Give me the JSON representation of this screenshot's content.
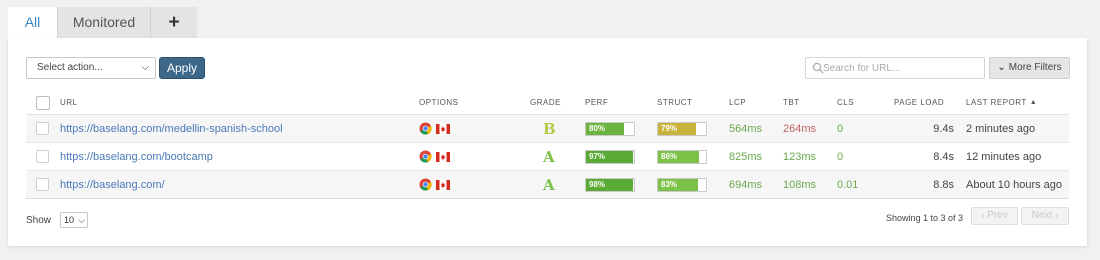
{
  "tabs": [
    {
      "label": "All"
    },
    {
      "label": "Monitored"
    },
    {
      "label": "+"
    }
  ],
  "toolbar": {
    "select_action": "Select action...",
    "apply": "Apply",
    "search_placeholder": "Search for URL...",
    "more_filters": "More Filters"
  },
  "columns": {
    "url": "URL",
    "options": "OPTIONS",
    "grade": "GRADE",
    "perf": "PERF",
    "struct": "STRUCT",
    "lcp": "LCP",
    "tbt": "TBT",
    "cls": "CLS",
    "page_load": "PAGE LOAD",
    "last_report": "LAST REPORT"
  },
  "rows": [
    {
      "url": "https://baselang.com/medellin-spanish-school",
      "grade": "B",
      "perf": "80%",
      "perf_value": 80,
      "perf_color": "#6cb33f",
      "struct": "79%",
      "struct_value": 79,
      "struct_color": "#c8b23a",
      "lcp": "564ms",
      "tbt": "264ms",
      "tbt_status": "red",
      "cls": "0",
      "page_load": "9.4s",
      "last_report": "2 minutes ago"
    },
    {
      "url": "https://baselang.com/bootcamp",
      "grade": "A",
      "perf": "97%",
      "perf_value": 97,
      "perf_color": "#5aaa35",
      "struct": "86%",
      "struct_value": 86,
      "struct_color": "#7cc248",
      "lcp": "825ms",
      "tbt": "123ms",
      "tbt_status": "green",
      "cls": "0",
      "page_load": "8.4s",
      "last_report": "12 minutes ago"
    },
    {
      "url": "https://baselang.com/",
      "grade": "A",
      "perf": "98%",
      "perf_value": 98,
      "perf_color": "#5aaa35",
      "struct": "83%",
      "struct_value": 83,
      "struct_color": "#7cc248",
      "lcp": "694ms",
      "tbt": "108ms",
      "tbt_status": "green",
      "cls": "0.01",
      "page_load": "8.8s",
      "last_report": "About 10 hours ago"
    }
  ],
  "footer": {
    "show_label": "Show",
    "page_size": "10",
    "showing": "Showing 1 to 3 of 3",
    "prev": "‹ Prev",
    "next": "Next ›"
  },
  "icons": {
    "search": "search-icon",
    "chrome": "chrome-icon",
    "flag": "canada-flag-icon",
    "sort": "sort-up-icon",
    "chevron": "chevron-down-icon"
  }
}
